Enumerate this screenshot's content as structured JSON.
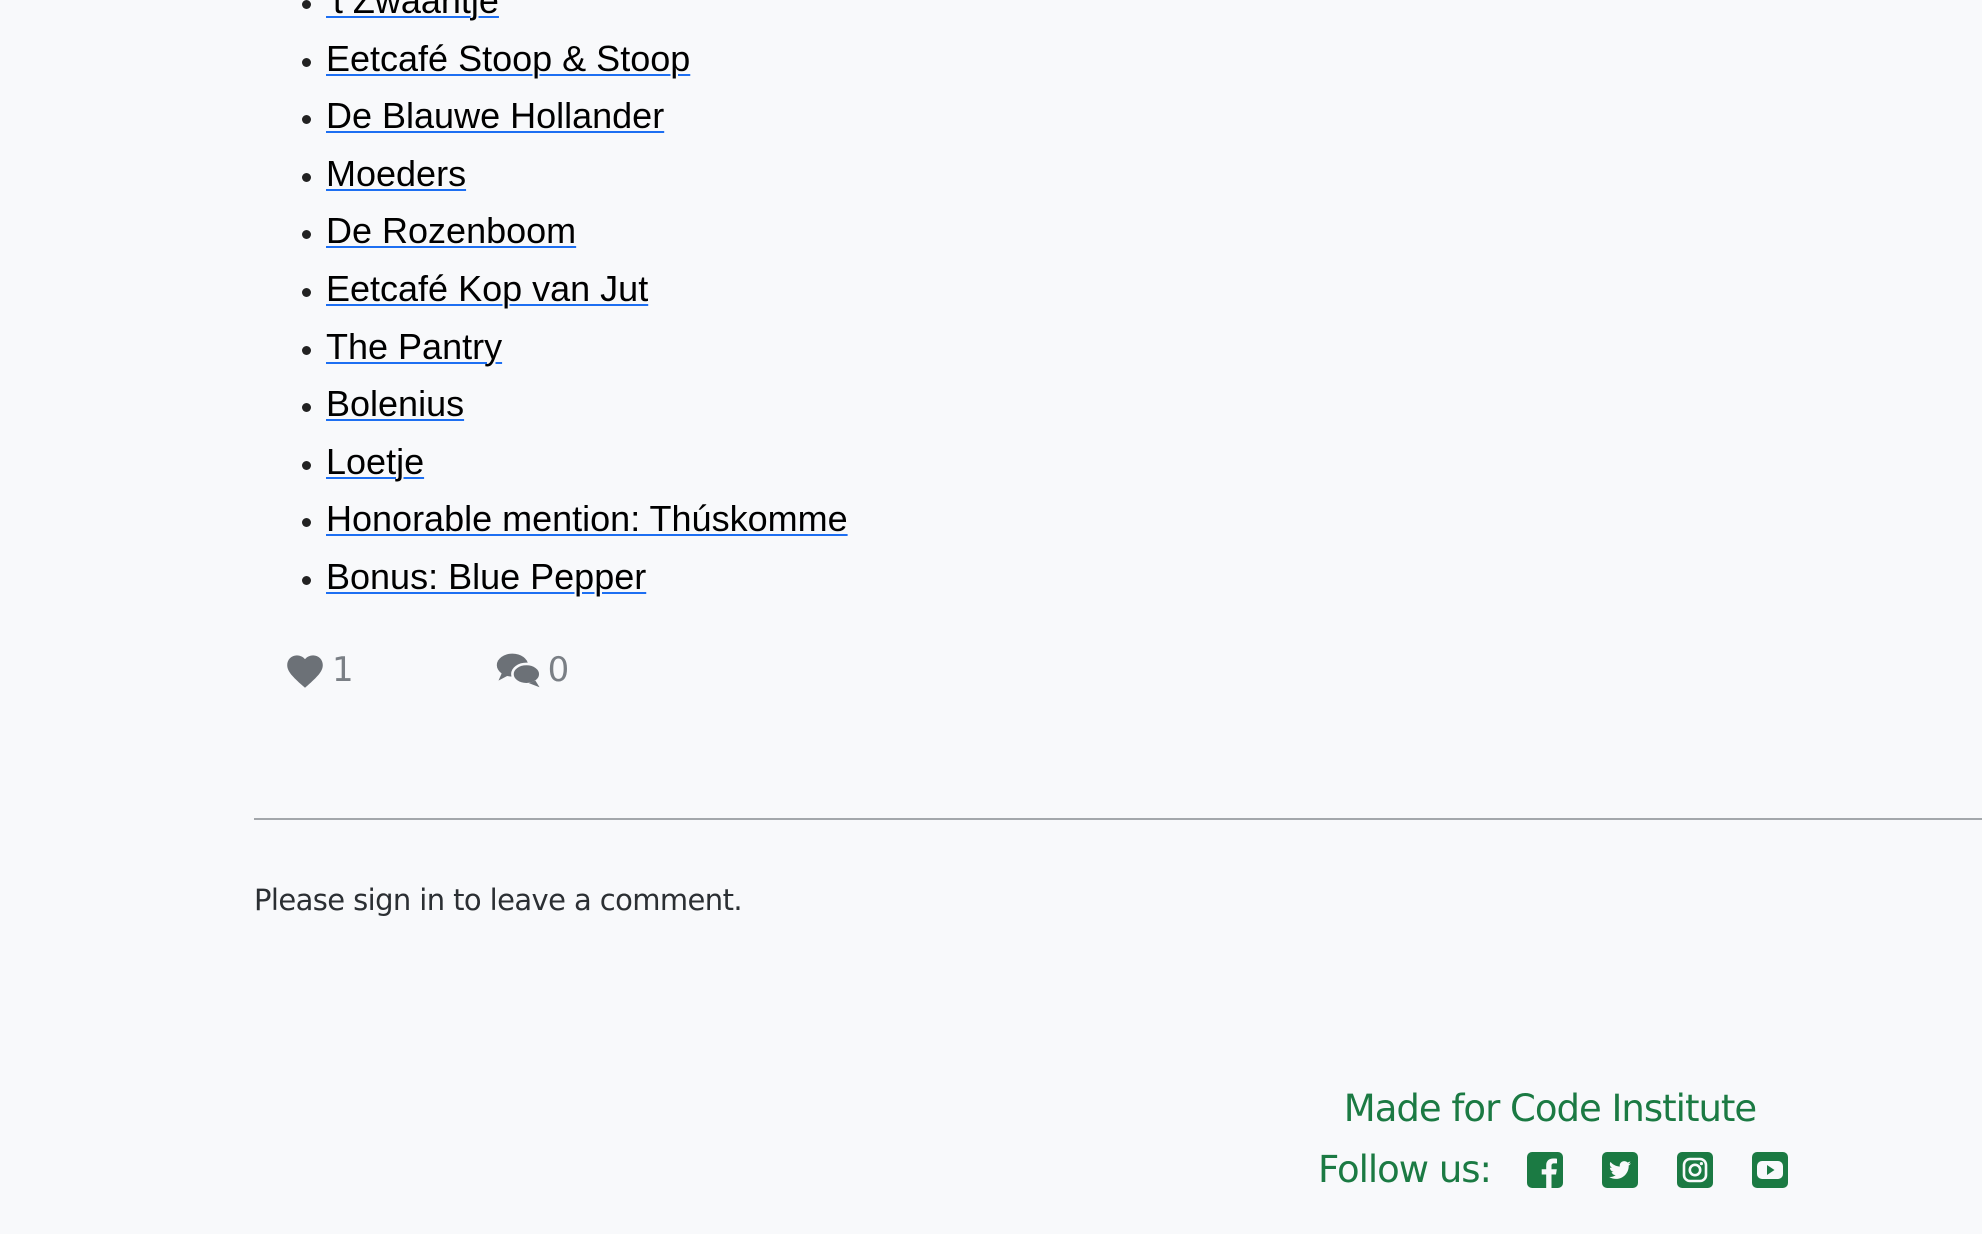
{
  "restaurants": [
    "'t Zwaantje",
    "Eetcafé Stoop & Stoop",
    "De Blauwe Hollander",
    "Moeders",
    "De Rozenboom",
    "Eetcafé Kop van Jut",
    "The Pantry",
    "Bolenius",
    "Loetje",
    "Honorable mention: Thúskomme",
    "Bonus: Blue Pepper"
  ],
  "post_stats": {
    "likes_icon": "heart-icon",
    "likes_count": "1",
    "comments_icon": "comments-icon",
    "comments_count": "0"
  },
  "comments": {
    "signin_prompt": "Please sign in to leave a comment."
  },
  "footer": {
    "made_for": "Made for Code Institute",
    "follow_label": "Follow us:",
    "social_icons": [
      "facebook-icon",
      "twitter-icon",
      "instagram-icon",
      "youtube-icon"
    ]
  },
  "colors": {
    "link_underline": "#1d6ff2",
    "footer_green": "#1b7a43",
    "stat_gray": "#7a7f85",
    "background": "#f8f9fb"
  }
}
